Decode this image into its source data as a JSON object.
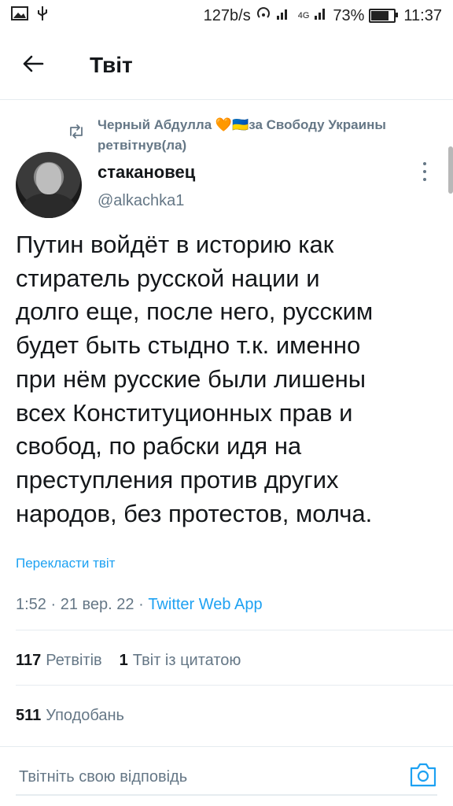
{
  "status_bar": {
    "speed": "127b/s",
    "network": "4G",
    "battery": "73%",
    "time": "11:37"
  },
  "header": {
    "title": "Твіт"
  },
  "retweet": {
    "retweeter": "Черный Абдулла 🧡🇺🇦за Свободу Украины",
    "action": "ретвітнув(ла)"
  },
  "tweet": {
    "author_name": "стакановец",
    "handle": "@alkachka1",
    "text": "Путин войдёт в историю как\nстиратель русской нации и\nдолго еще, после него, русским\nбудет быть стыдно т.к.  именно\nпри нём русские были лишены\nвсех Конституционных прав и\nсвобод, по рабски  идя на\nпреступления против других\nнародов, без протестов, молча.",
    "translate_label": "Перекласти твіт",
    "time": "1:52",
    "date": "21 вер. 22",
    "source": "Twitter Web App"
  },
  "stats": {
    "retweets_count": "117",
    "retweets_label": "Ретвітів",
    "quotes_count": "1",
    "quotes_label": "Твіт із цитатою",
    "likes_count": "511",
    "likes_label": "Уподобань"
  },
  "reply": {
    "placeholder": "Твітніть свою відповідь"
  },
  "colors": {
    "accent": "#1da1f2",
    "secondary_text": "#657786",
    "divider": "#e6ecf0"
  },
  "icons": {
    "back": "arrow-left-icon",
    "retweet": "retweet-icon",
    "more": "more-vertical-icon",
    "camera": "camera-icon"
  }
}
